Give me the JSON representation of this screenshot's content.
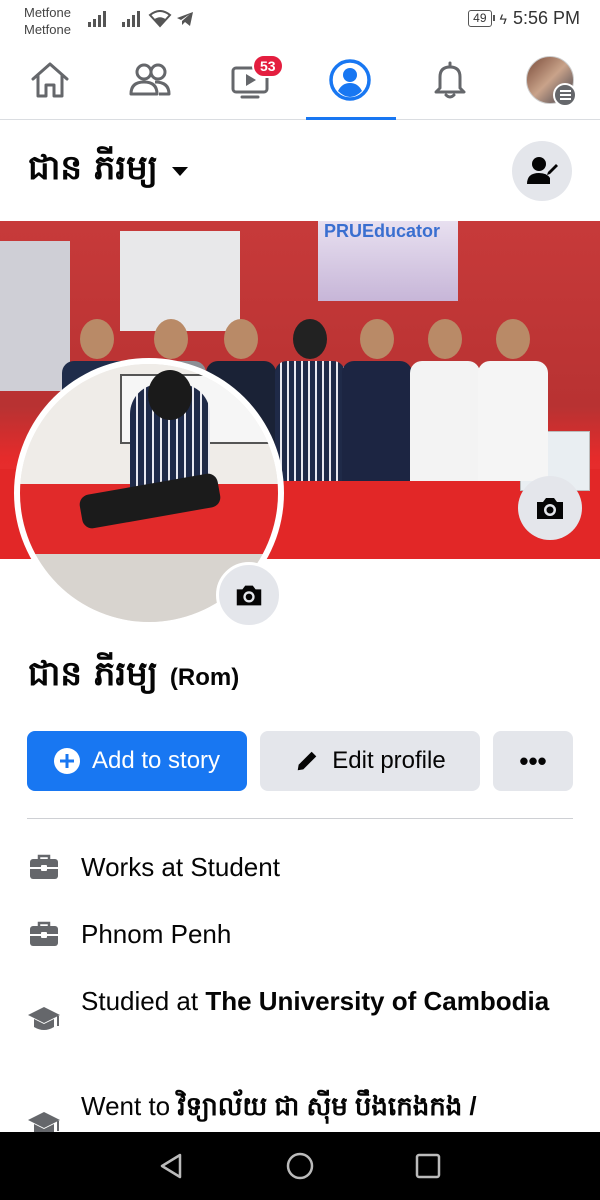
{
  "status_bar": {
    "carrier_1": "Metfone",
    "carrier_2": "Metfone",
    "battery": "49",
    "time": "5:56 PM"
  },
  "nav": {
    "items": [
      {
        "name": "home",
        "icon": "home-icon"
      },
      {
        "name": "friends",
        "icon": "friends-icon"
      },
      {
        "name": "watch",
        "icon": "watch-icon",
        "badge": "53"
      },
      {
        "name": "profile",
        "icon": "profile-icon",
        "active": true
      },
      {
        "name": "notifications",
        "icon": "bell-icon"
      },
      {
        "name": "menu",
        "icon": "menu-avatar"
      }
    ],
    "accent": "#1877f2",
    "badge_color": "#e41e3f"
  },
  "profile": {
    "header_name": "ជាន ភីរម្យ",
    "full_name": "ជាន ភីរម្យ",
    "alternate_name": "(Rom)",
    "cover_banner_text": "PRUEducator"
  },
  "actions": {
    "add_story": "Add to story",
    "edit_profile": "Edit profile",
    "more": "•••"
  },
  "details": {
    "work_1": "Works at Student",
    "location": "Phnom Penh",
    "studied_prefix": "Studied at ",
    "studied_school": "The University of Cambodia",
    "went_prefix": "Went to ",
    "went_school": "វិទ្យាល័យ ជា ស៊ីម បឹងកេងកង /"
  }
}
